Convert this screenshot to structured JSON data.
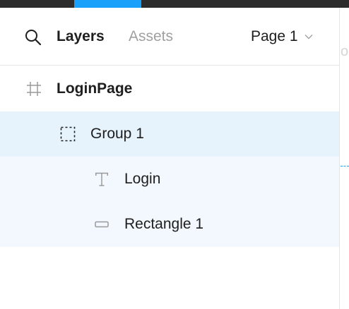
{
  "panel": {
    "tabs": {
      "layers": "Layers",
      "assets": "Assets"
    },
    "page_selector": {
      "label": "Page 1"
    }
  },
  "layers": {
    "frame": {
      "label": "LoginPage",
      "icon": "frame-hash-icon"
    },
    "group": {
      "label": "Group 1",
      "icon": "group-dashed-icon"
    },
    "text": {
      "label": "Login",
      "icon": "text-layer-icon"
    },
    "rectangle": {
      "label": "Rectangle 1",
      "icon": "rectangle-layer-icon"
    }
  },
  "canvas": {
    "partial_text": "og"
  },
  "colors": {
    "toolbar": "#2c2c2c",
    "accent": "#18a0fb",
    "selected_row": "#e6f3fd",
    "child_row": "#f2f8fe"
  }
}
